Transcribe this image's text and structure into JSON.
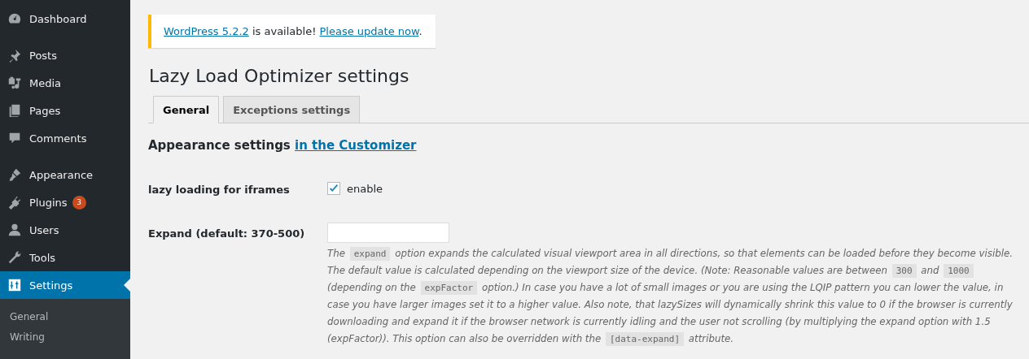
{
  "sidebar": {
    "groups": [
      [
        {
          "label": "Dashboard",
          "selected": false
        }
      ],
      [
        {
          "label": "Posts",
          "selected": false
        },
        {
          "label": "Media",
          "selected": false
        },
        {
          "label": "Pages",
          "selected": false
        },
        {
          "label": "Comments",
          "selected": false
        }
      ],
      [
        {
          "label": "Appearance",
          "selected": false
        },
        {
          "label": "Plugins",
          "selected": false,
          "badge": "3"
        },
        {
          "label": "Users",
          "selected": false
        },
        {
          "label": "Tools",
          "selected": false
        },
        {
          "label": "Settings",
          "selected": true
        }
      ]
    ],
    "submenu": [
      {
        "label": "General",
        "selected": false
      },
      {
        "label": "Writing",
        "selected": false
      }
    ]
  },
  "notice": {
    "parts": [
      {
        "kind": "link",
        "text": "WordPress 5.2.2"
      },
      {
        "kind": "text",
        "text": " is available! "
      },
      {
        "kind": "link",
        "text": "Please update now"
      },
      {
        "kind": "text",
        "text": "."
      }
    ]
  },
  "page_title": "Lazy Load Optimizer settings",
  "tabs": [
    {
      "label": "General",
      "selected": true
    },
    {
      "label": "Exceptions settings",
      "selected": false
    }
  ],
  "section": {
    "title": "Appearance settings",
    "link": "in the Customizer"
  },
  "fields": [
    {
      "kind": "checkbox",
      "label": "lazy loading for iframes",
      "option": "enable",
      "checked": true
    },
    {
      "kind": "text",
      "label": "Expand (default: 370-500)",
      "description": [
        {
          "kind": "text",
          "text": "The "
        },
        {
          "kind": "code",
          "text": "expand"
        },
        {
          "kind": "text",
          "text": " option expands the calculated visual viewport area in all directions, so that elements can be loaded before they become visible. The default value is calculated depending on the viewport size of the device. (Note: Reasonable values are between "
        },
        {
          "kind": "code",
          "text": "300"
        },
        {
          "kind": "text",
          "text": " and "
        },
        {
          "kind": "code",
          "text": "1000"
        },
        {
          "kind": "text",
          "text": " (depending on the "
        },
        {
          "kind": "code",
          "text": "expFactor"
        },
        {
          "kind": "text",
          "text": " option.) In case you have a lot of small images or you are using the LQIP pattern you can lower the value, in case you have larger images set it to a higher value. Also note, that lazySizes will dynamically shrink this value to 0 if the browser is currently downloading and expand it if the browser network is currently idling and the user not scrolling (by multiplying the expand option with 1.5 (expFactor)). This option can also be overridden with the "
        },
        {
          "kind": "code",
          "text": "[data-expand]"
        },
        {
          "kind": "text",
          "text": " attribute."
        }
      ]
    }
  ]
}
